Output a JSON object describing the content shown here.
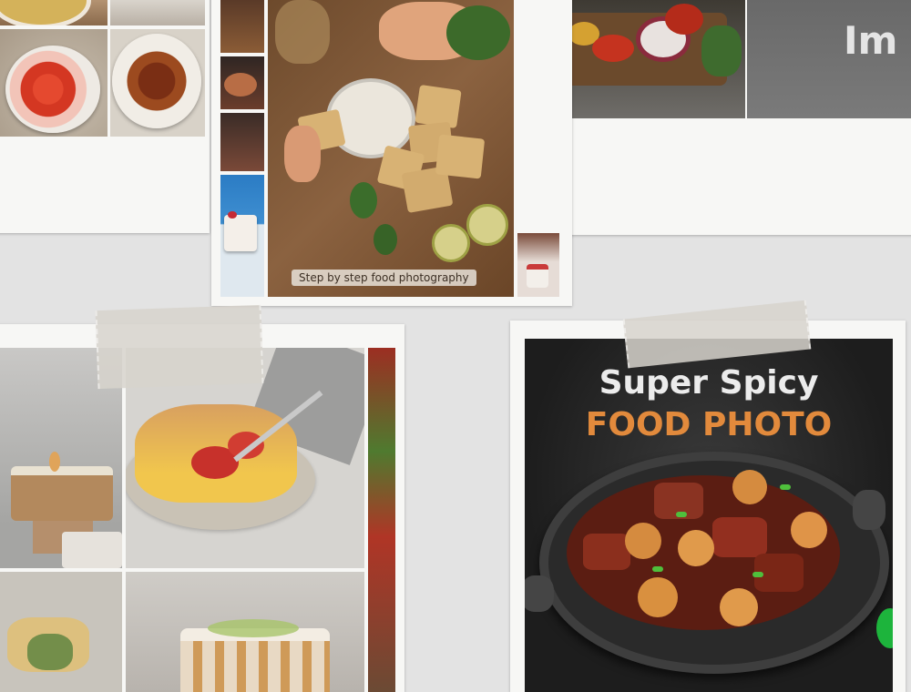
{
  "collage": {
    "print_center": {
      "caption": "Step by step food photography"
    },
    "print_top_right": {
      "partial_title": "Im"
    },
    "print_bottom_right": {
      "title_line1": "Super Spicy",
      "title_line2": "FOOD PHOTO"
    }
  },
  "colors": {
    "background": "#e3e3e3",
    "paper": "#f7f7f5",
    "poster_dark": "#1d1d1d",
    "poster_accent": "#e28a3c",
    "poster_title": "#ececec"
  }
}
